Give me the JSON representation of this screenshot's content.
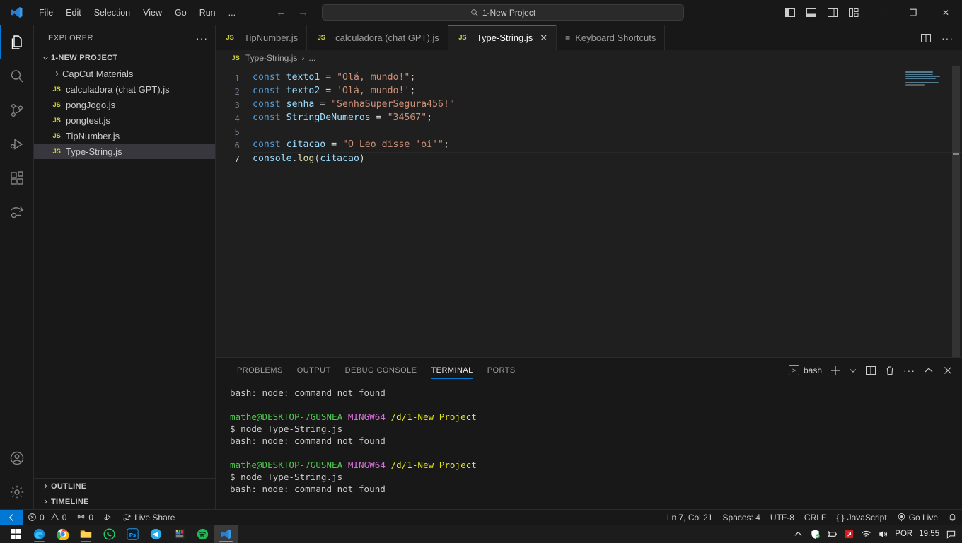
{
  "titlebar": {
    "menus": [
      "File",
      "Edit",
      "Selection",
      "View",
      "Go",
      "Run",
      "..."
    ],
    "search_value": "1-New Project",
    "back_icon": "arrow-left-icon",
    "forward_icon": "arrow-right-icon",
    "search_icon": "search-icon",
    "layout_icons": [
      "toggle-primary-sidebar-icon",
      "toggle-panel-icon",
      "toggle-secondary-sidebar-icon",
      "customize-layout-icon"
    ],
    "window_controls": {
      "minimize": "─",
      "maximize": "❐",
      "close": "✕"
    }
  },
  "activitybar": {
    "items": [
      {
        "name": "explorer",
        "icon": "files-icon",
        "active": true
      },
      {
        "name": "search",
        "icon": "search-icon",
        "active": false
      },
      {
        "name": "source-control",
        "icon": "source-control-icon",
        "active": false
      },
      {
        "name": "run-and-debug",
        "icon": "run-debug-icon",
        "active": false
      },
      {
        "name": "extensions",
        "icon": "extensions-icon",
        "active": false
      },
      {
        "name": "live-share",
        "icon": "live-share-icon",
        "active": false
      }
    ],
    "bottom": [
      {
        "name": "accounts",
        "icon": "account-icon"
      },
      {
        "name": "settings",
        "icon": "gear-icon"
      }
    ]
  },
  "sidebar": {
    "title": "EXPLORER",
    "more_actions": "···",
    "root": "1-NEW PROJECT",
    "files": [
      {
        "label": "CapCut Materials",
        "type": "folder",
        "selected": false
      },
      {
        "label": "calculadora (chat GPT).js",
        "type": "js",
        "selected": false
      },
      {
        "label": "pongJogo.js",
        "type": "js",
        "selected": false
      },
      {
        "label": "pongtest.js",
        "type": "js",
        "selected": false
      },
      {
        "label": "TipNumber.js",
        "type": "js",
        "selected": false
      },
      {
        "label": "Type-String.js",
        "type": "js",
        "selected": true
      }
    ],
    "sections": [
      "OUTLINE",
      "TIMELINE"
    ]
  },
  "editor": {
    "tabs": [
      {
        "label": "TipNumber.js",
        "icon": "js-icon",
        "active": false,
        "closable": false
      },
      {
        "label": "calculadora (chat GPT).js",
        "icon": "js-icon",
        "active": false,
        "closable": false
      },
      {
        "label": "Type-String.js",
        "icon": "js-icon",
        "active": true,
        "closable": true,
        "close": "✕"
      },
      {
        "label": "Keyboard Shortcuts",
        "icon": "keyboard-icon",
        "active": false,
        "closable": false
      }
    ],
    "actions": [
      "split-editor-icon",
      "more-actions-icon"
    ],
    "breadcrumb": {
      "file": "Type-String.js",
      "icon": "js-icon",
      "separator": "›",
      "tail": "..."
    },
    "lines": [
      {
        "num": "1",
        "tokens": [
          {
            "t": "const ",
            "c": "kw"
          },
          {
            "t": "texto1",
            "c": "var"
          },
          {
            "t": " = ",
            "c": "op"
          },
          {
            "t": "\"Olá, mundo!\"",
            "c": "str"
          },
          {
            "t": ";",
            "c": "pn"
          }
        ]
      },
      {
        "num": "2",
        "tokens": [
          {
            "t": "const ",
            "c": "kw"
          },
          {
            "t": "texto2",
            "c": "var"
          },
          {
            "t": " = ",
            "c": "op"
          },
          {
            "t": "'Olá, mundo!'",
            "c": "str"
          },
          {
            "t": ";",
            "c": "pn"
          }
        ]
      },
      {
        "num": "3",
        "tokens": [
          {
            "t": "const ",
            "c": "kw"
          },
          {
            "t": "senha",
            "c": "var"
          },
          {
            "t": " = ",
            "c": "op"
          },
          {
            "t": "\"SenhaSuperSegura456!\"",
            "c": "str"
          }
        ]
      },
      {
        "num": "4",
        "tokens": [
          {
            "t": "const ",
            "c": "kw"
          },
          {
            "t": "StringDeNumeros",
            "c": "var"
          },
          {
            "t": " = ",
            "c": "op"
          },
          {
            "t": "\"34567\"",
            "c": "str"
          },
          {
            "t": ";",
            "c": "pn"
          }
        ]
      },
      {
        "num": "5",
        "tokens": []
      },
      {
        "num": "6",
        "tokens": [
          {
            "t": "const ",
            "c": "kw"
          },
          {
            "t": "citacao",
            "c": "var"
          },
          {
            "t": " = ",
            "c": "op"
          },
          {
            "t": "\"O Leo disse 'oi'\"",
            "c": "str"
          },
          {
            "t": ";",
            "c": "pn"
          }
        ]
      },
      {
        "num": "7",
        "current": true,
        "tokens": [
          {
            "t": "console",
            "c": "var"
          },
          {
            "t": ".",
            "c": "pn"
          },
          {
            "t": "log",
            "c": "fnc"
          },
          {
            "t": "(",
            "c": "pn"
          },
          {
            "t": "citacao",
            "c": "var"
          },
          {
            "t": ")",
            "c": "pn"
          }
        ]
      }
    ]
  },
  "panel": {
    "tabs": [
      "PROBLEMS",
      "OUTPUT",
      "DEBUG CONSOLE",
      "TERMINAL",
      "PORTS"
    ],
    "active_tab": "TERMINAL",
    "shell_label": "bash",
    "shell_icon": "terminal-icon",
    "actions": [
      "new-terminal-icon",
      "terminal-dropdown-icon",
      "split-terminal-icon",
      "kill-terminal-icon",
      "more-actions-icon",
      "maximize-panel-icon",
      "close-panel-icon"
    ],
    "terminal_lines": [
      {
        "segments": [
          {
            "t": "bash: node: command not found",
            "c": "t-txt"
          }
        ]
      },
      {
        "segments": []
      },
      {
        "segments": [
          {
            "t": "mathe@DESKTOP-7GUSNEA",
            "c": "t-user"
          },
          {
            "t": " ",
            "c": "t-txt"
          },
          {
            "t": "MINGW64",
            "c": "t-mingw"
          },
          {
            "t": " ",
            "c": "t-txt"
          },
          {
            "t": "/d/1-New Project",
            "c": "t-path"
          }
        ]
      },
      {
        "segments": [
          {
            "t": "$ node Type-String.js",
            "c": "t-txt"
          }
        ]
      },
      {
        "segments": [
          {
            "t": "bash: node: command not found",
            "c": "t-txt"
          }
        ]
      },
      {
        "segments": []
      },
      {
        "segments": [
          {
            "t": "mathe@DESKTOP-7GUSNEA",
            "c": "t-user"
          },
          {
            "t": " ",
            "c": "t-txt"
          },
          {
            "t": "MINGW64",
            "c": "t-mingw"
          },
          {
            "t": " ",
            "c": "t-txt"
          },
          {
            "t": "/d/1-New Project",
            "c": "t-path"
          }
        ]
      },
      {
        "segments": [
          {
            "t": "$ node Type-String.js",
            "c": "t-txt"
          }
        ]
      },
      {
        "segments": [
          {
            "t": "bash: node: command not found",
            "c": "t-txt"
          }
        ]
      }
    ]
  },
  "statusbar": {
    "remote_icon": "remote-window-icon",
    "errors": "0",
    "warnings": "0",
    "ports": "0",
    "radio_tower_icon": "radio-tower-icon",
    "error_icon": "error-circle-icon",
    "warning_icon": "warning-triangle-icon",
    "debug_icon": "debug-alt-icon",
    "live_share_icon": "live-share-icon",
    "live_share": "Live Share",
    "cursor_position": "Ln 7, Col 21",
    "indentation": "Spaces: 4",
    "encoding": "UTF-8",
    "eol": "CRLF",
    "language": "JavaScript",
    "language_icon": "braces-icon",
    "go_live": "Go Live",
    "go_live_icon": "broadcast-icon",
    "bell_icon": "bell-icon"
  },
  "taskbar": {
    "start_icon": "windows-start-icon",
    "apps": [
      {
        "name": "microsoft-edge",
        "running": true
      },
      {
        "name": "google-chrome",
        "running": false
      },
      {
        "name": "file-explorer",
        "running": true
      },
      {
        "name": "whatsapp",
        "running": false
      },
      {
        "name": "photoshop",
        "running": false
      },
      {
        "name": "telegram",
        "running": false
      },
      {
        "name": "app-icon",
        "running": false
      },
      {
        "name": "spotify",
        "running": false
      },
      {
        "name": "visual-studio-code",
        "running": true,
        "active": true
      }
    ],
    "tray": {
      "chevron_icon": "chevron-up-icon",
      "security_icon": "windows-security-icon",
      "battery_icon": "battery-icon",
      "app_icon": "tray-app-icon",
      "network_icon": "wifi-icon",
      "volume_icon": "speaker-icon",
      "language": "POR",
      "clock": "19:55",
      "notification_icon": "notification-icon"
    }
  },
  "colors": {
    "accent": "#0078d4",
    "editor_bg": "#1f1f1f",
    "chrome_bg": "#181818",
    "string": "#ce9178",
    "keyword": "#569cd6",
    "variable": "#9cdcfe",
    "function": "#dcdcaa",
    "js_badge": "#cbcb41"
  }
}
